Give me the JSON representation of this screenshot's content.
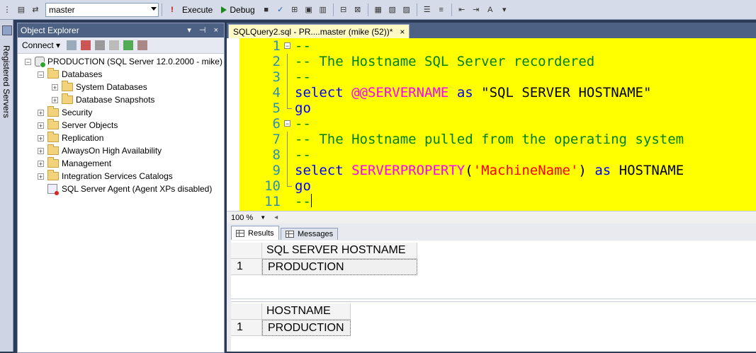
{
  "toolbar": {
    "database": "master",
    "execute_label": "Execute",
    "debug_label": "Debug"
  },
  "left_tab": {
    "label": "Registered Servers"
  },
  "object_explorer": {
    "title": "Object Explorer",
    "connect_label": "Connect",
    "tree": {
      "server": "PRODUCTION (SQL Server 12.0.2000 - mike)",
      "databases": "Databases",
      "system_databases": "System Databases",
      "database_snapshots": "Database Snapshots",
      "security": "Security",
      "server_objects": "Server Objects",
      "replication": "Replication",
      "alwayson": "AlwaysOn High Availability",
      "management": "Management",
      "integration_services": "Integration Services Catalogs",
      "agent": "SQL Server Agent (Agent XPs disabled)"
    }
  },
  "editor": {
    "tab_title": "SQLQuery2.sql - PR....master (mike (52))*",
    "close_glyph": "×",
    "highlight_color": "#ffff00",
    "line_numbers": [
      "1",
      "2",
      "3",
      "4",
      "5",
      "6",
      "7",
      "8",
      "9",
      "10",
      "11"
    ],
    "lines": {
      "l1": "--",
      "l2": "-- The Hostname SQL Server recordered",
      "l3": "--",
      "l4_kw": "select",
      "l4_fn": "@@SERVERNAME",
      "l4_as": "as",
      "l4_str": "\"SQL SERVER HOSTNAME\"",
      "l5": "go",
      "l6": "--",
      "l7": "-- The Hostname pulled from the operating system",
      "l8": "--",
      "l9_kw": "select",
      "l9_fn": "SERVERPROPERTY",
      "l9_open": "(",
      "l9_str": "'MachineName'",
      "l9_close": ")",
      "l9_as": "as",
      "l9_alias": "HOSTNAME",
      "l10": "go",
      "l11": "--"
    }
  },
  "zoom": {
    "value": "100 %"
  },
  "results_tabs": {
    "results_label": "Results",
    "messages_label": "Messages"
  },
  "results": {
    "grid1": {
      "header": "SQL SERVER HOSTNAME",
      "row_num": "1",
      "value": "PRODUCTION"
    },
    "grid2": {
      "header": "HOSTNAME",
      "row_num": "1",
      "value": "PRODUCTION"
    }
  }
}
